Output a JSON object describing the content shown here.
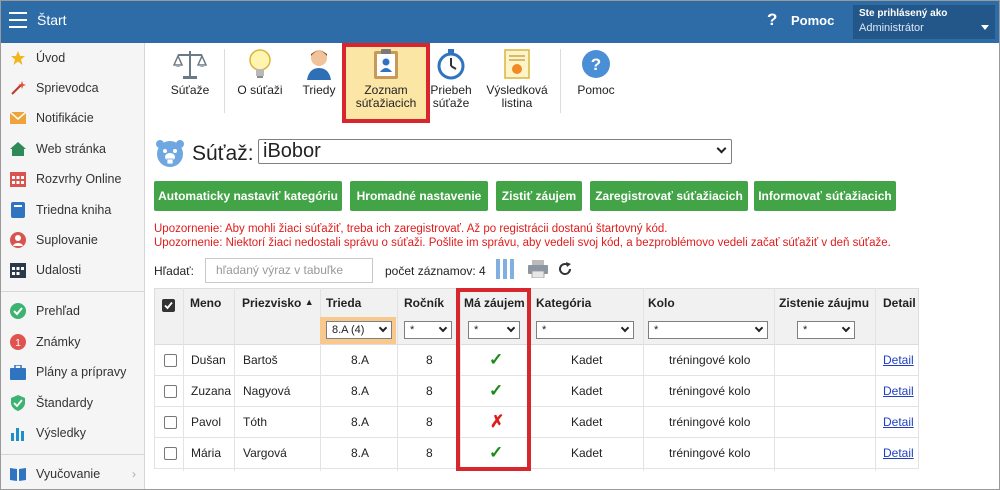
{
  "topbar": {
    "title": "Štart",
    "help_label": "Pomoc",
    "help_glyph": "?",
    "user_line1": "Ste prihlásený ako",
    "user_line2": "Administrátor"
  },
  "sidebar": {
    "items": [
      {
        "label": "Úvod",
        "icon": "star-icon"
      },
      {
        "label": "Sprievodca",
        "icon": "wand-icon"
      },
      {
        "label": "Notifikácie",
        "icon": "envelope-icon"
      },
      {
        "label": "Web stránka",
        "icon": "home-icon"
      },
      {
        "label": "Rozvrhy Online",
        "icon": "calendar-icon"
      },
      {
        "label": "Triedna kniha",
        "icon": "book-icon"
      },
      {
        "label": "Suplovanie",
        "icon": "person-icon"
      },
      {
        "label": "Udalosti",
        "icon": "calendar-grid-icon"
      },
      {
        "label": "Prehľad",
        "icon": "check-circle-icon"
      },
      {
        "label": "Známky",
        "icon": "grades-icon"
      },
      {
        "label": "Plány a prípravy",
        "icon": "briefcase-icon"
      },
      {
        "label": "Štandardy",
        "icon": "shield-icon"
      },
      {
        "label": "Výsledky",
        "icon": "bar-chart-icon"
      },
      {
        "label": "Vyučovanie",
        "icon": "book-open-icon"
      }
    ],
    "chevron": "›"
  },
  "toolbar": {
    "items": [
      {
        "label1": "Súťaže",
        "label2": "",
        "icon": "scales-icon"
      },
      {
        "label1": "O súťaži",
        "label2": "",
        "icon": "lightbulb-icon"
      },
      {
        "label1": "Triedy",
        "label2": "",
        "icon": "student-icon"
      },
      {
        "label1": "Zoznam",
        "label2": "súťažiacich",
        "icon": "clipboard-icon"
      },
      {
        "label1": "Priebeh",
        "label2": "súťaže",
        "icon": "stopwatch-icon"
      },
      {
        "label1": "Výsledková",
        "label2": "listina",
        "icon": "certificate-icon"
      },
      {
        "label1": "Pomoc",
        "label2": "",
        "icon": "help-circle-icon"
      }
    ]
  },
  "contest": {
    "label": "Súťaž:",
    "selected": "iBobor"
  },
  "actions": [
    "Automaticky nastaviť kategóriu",
    "Hromadné nastavenie",
    "Zistiť záujem",
    "Zaregistrovať súťažiacich",
    "Informovať súťažiacich"
  ],
  "warnings": [
    "Upozornenie: Aby mohli žiaci súťažiť, treba ich zaregistrovať. Až po registrácii dostanú štartovný kód.",
    "Upozornenie: Niektorí žiaci nedostali správu o súťaži. Pošlite im správu, aby vedeli svoj kód, a bezproblémovo vedeli začať súťažiť v deň súťaže."
  ],
  "search": {
    "label": "Hľadať:",
    "placeholder": "hľadaný výraz v tabuľke",
    "count_label": "počet záznamov: 4"
  },
  "table": {
    "headers": [
      "Meno",
      "Priezvisko",
      "Trieda",
      "Ročník",
      "Má záujem",
      "Kategória",
      "Kolo",
      "Zistenie záujmu",
      "Detail"
    ],
    "sort_indicator": "▲",
    "filters": {
      "trieda": "8.A (4)",
      "rocnik": "*",
      "ma_zaujem": "*",
      "kategoria": "*",
      "kolo": "*",
      "zistenie": "*"
    },
    "rows": [
      {
        "meno": "Dušan",
        "priezvisko": "Bartoš",
        "trieda": "8.A",
        "rocnik": "8",
        "ma_zaujem": "✓",
        "ma_zaujem_status": "yes",
        "kategoria": "Kadet",
        "kolo": "tréningové kolo",
        "zistenie": "",
        "detail": "Detail"
      },
      {
        "meno": "Zuzana",
        "priezvisko": "Nagyová",
        "trieda": "8.A",
        "rocnik": "8",
        "ma_zaujem": "✓",
        "ma_zaujem_status": "yes",
        "kategoria": "Kadet",
        "kolo": "tréningové kolo",
        "zistenie": "",
        "detail": "Detail"
      },
      {
        "meno": "Pavol",
        "priezvisko": "Tóth",
        "trieda": "8.A",
        "rocnik": "8",
        "ma_zaujem": "✗",
        "ma_zaujem_status": "no",
        "kategoria": "Kadet",
        "kolo": "tréningové kolo",
        "zistenie": "",
        "detail": "Detail"
      },
      {
        "meno": "Mária",
        "priezvisko": "Vargová",
        "trieda": "8.A",
        "rocnik": "8",
        "ma_zaujem": "✓",
        "ma_zaujem_status": "yes",
        "kategoria": "Kadet",
        "kolo": "tréningové kolo",
        "zistenie": "",
        "detail": "Detail"
      }
    ]
  },
  "colors": {
    "topbar": "#2e6ca8",
    "action_green": "#43a447",
    "warning_red": "#e01b1b",
    "highlight_red": "#d7262e",
    "active_tool_bg": "#fbe6a6"
  }
}
